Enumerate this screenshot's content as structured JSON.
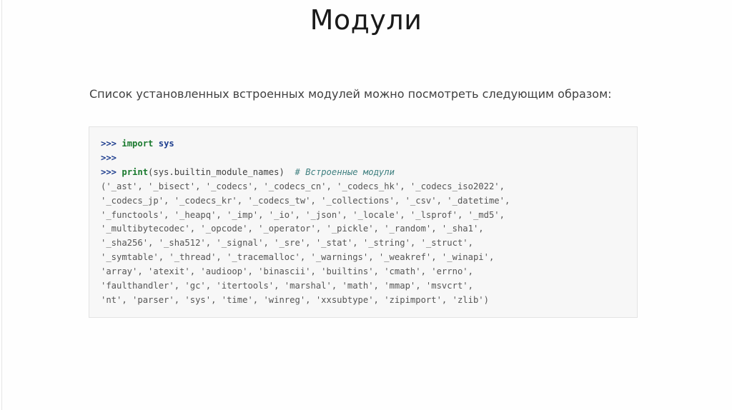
{
  "slide": {
    "title": "Модули",
    "intro_text": "Список установленных встроенных модулей можно посмотреть следующим образом:"
  },
  "code": {
    "line1": {
      "prompt": ">>>",
      "keyword": "import",
      "module": "sys"
    },
    "line2": {
      "prompt": ">>>"
    },
    "line3": {
      "prompt": ">>>",
      "func": "print",
      "args": "(sys.builtin_module_names)",
      "comment": "# Встроенные модули"
    },
    "output": [
      "('_ast', '_bisect', '_codecs', '_codecs_cn', '_codecs_hk', '_codecs_iso2022',",
      "'_codecs_jp', '_codecs_kr', '_codecs_tw', '_collections', '_csv', '_datetime',",
      "'_functools', '_heapq', '_imp', '_io', '_json', '_locale', '_lsprof', '_md5',",
      "'_multibytecodec', '_opcode', '_operator', '_pickle', '_random', '_sha1',",
      "'_sha256', '_sha512', '_signal', '_sre', '_stat', '_string', '_struct',",
      "'_symtable', '_thread', '_tracemalloc', '_warnings', '_weakref', '_winapi',",
      "'array', 'atexit', 'audioop', 'binascii', 'builtins', 'cmath', 'errno',",
      "'faulthandler', 'gc', 'itertools', 'marshal', 'math', 'mmap', 'msvcrt',",
      "'nt', 'parser', 'sys', 'time', 'winreg', 'xxsubtype', 'zipimport', 'zlib')"
    ]
  },
  "colors": {
    "prompt": "#1f3f8f",
    "keyword": "#1a7a2e",
    "comment": "#408080",
    "code_background": "#f7f7f7"
  }
}
